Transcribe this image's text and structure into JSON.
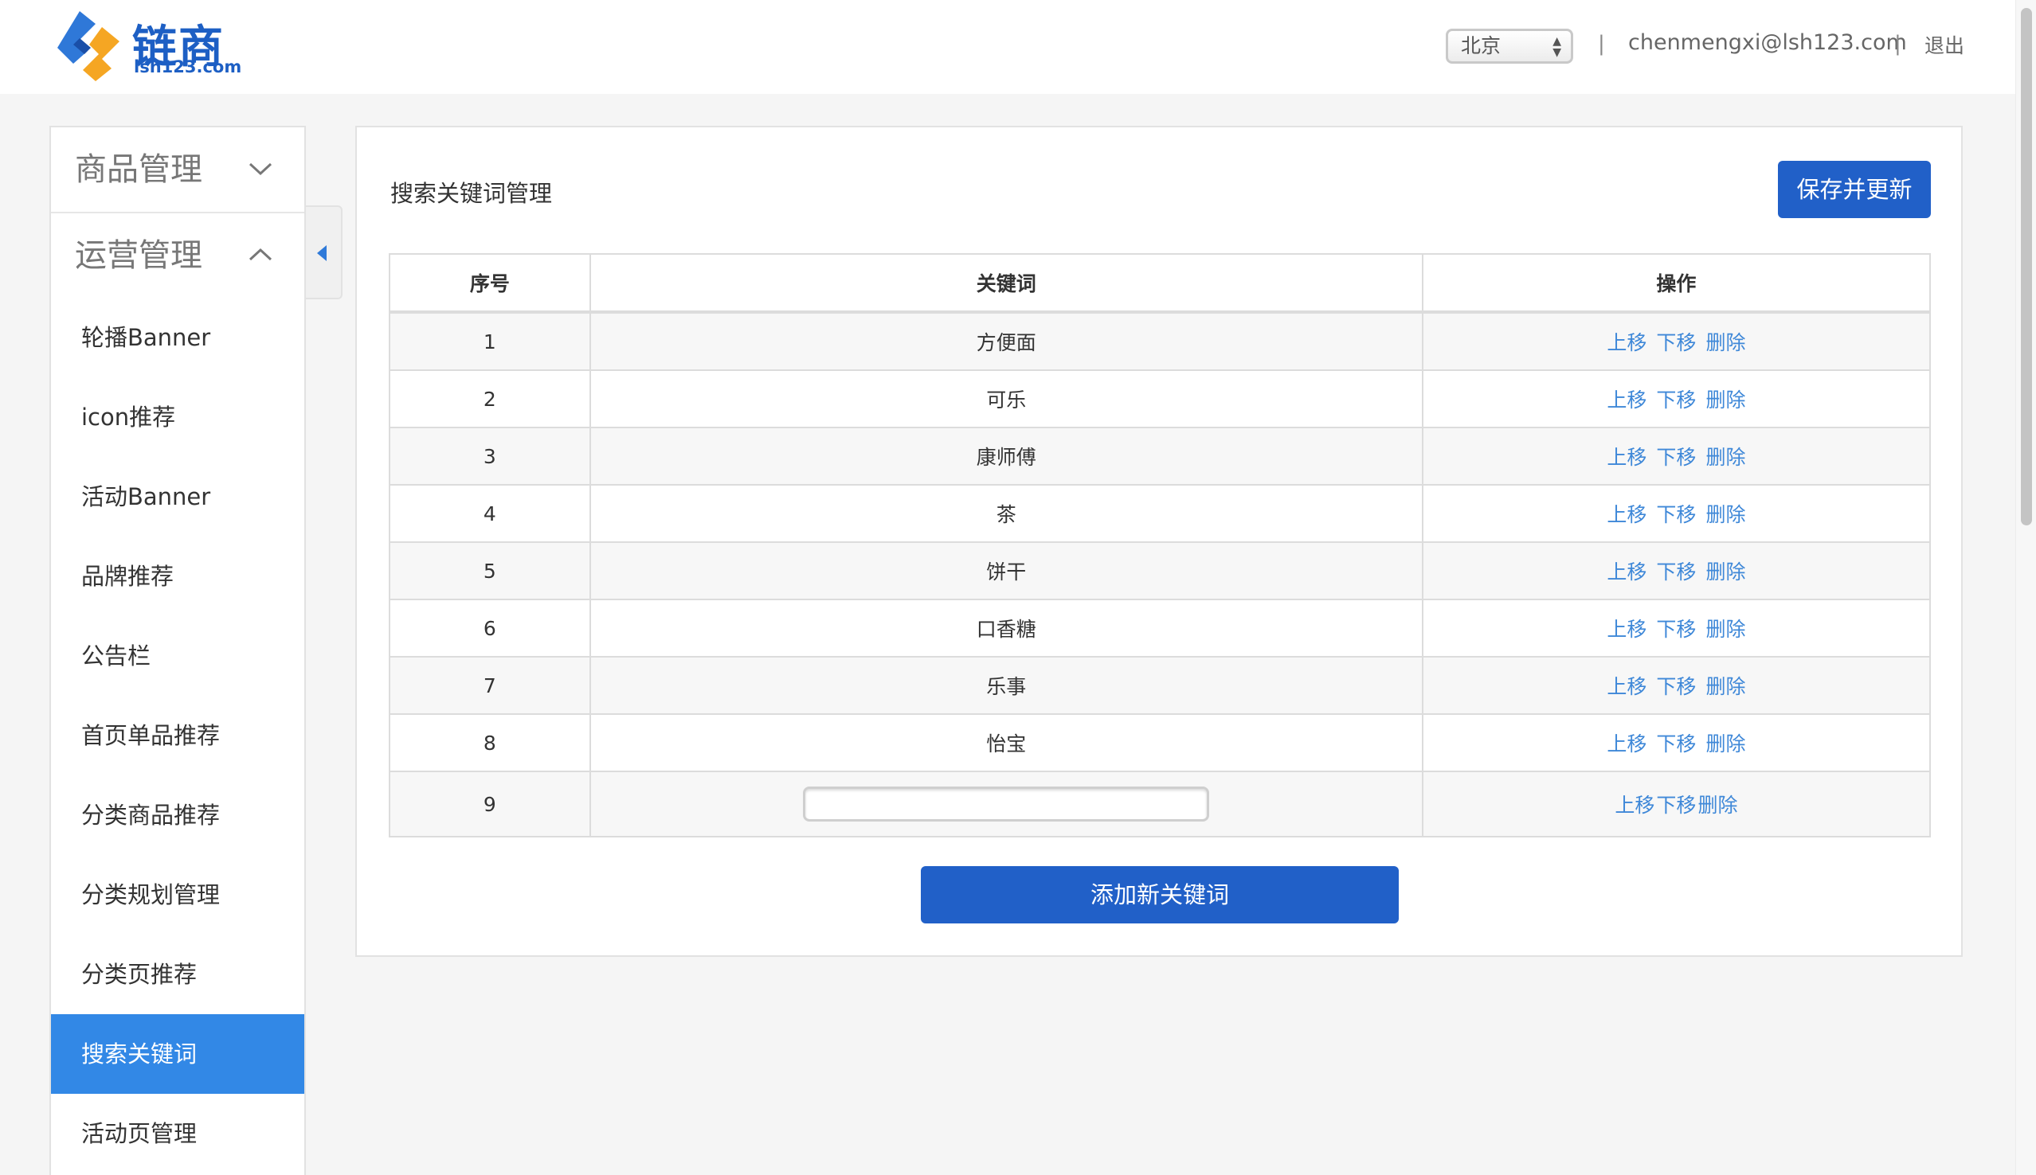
{
  "brand": {
    "name": "链商",
    "sub": "lsh123.com",
    "colors": {
      "primary": "#2160c8",
      "active": "#3288e6",
      "link": "#3f88d8"
    }
  },
  "header": {
    "city": "北京",
    "separator": "|",
    "email": "chenmengxi@lsh123.com",
    "logout": "退出"
  },
  "sidebar": {
    "groups": [
      {
        "label": "商品管理",
        "icon": "chevron-down-icon"
      },
      {
        "label": "运营管理",
        "icon": "chevron-up-icon"
      }
    ],
    "items": [
      {
        "label": "轮播Banner"
      },
      {
        "label": "icon推荐"
      },
      {
        "label": "活动Banner"
      },
      {
        "label": "品牌推荐"
      },
      {
        "label": "公告栏"
      },
      {
        "label": "首页单品推荐"
      },
      {
        "label": "分类商品推荐"
      },
      {
        "label": "分类规划管理"
      },
      {
        "label": "分类页推荐"
      },
      {
        "label": "搜索关键词",
        "active": true
      },
      {
        "label": "活动页管理"
      }
    ]
  },
  "panel": {
    "title": "搜索关键词管理",
    "save_label": "保存并更新",
    "add_label": "添加新关键词",
    "table": {
      "headers": [
        "序号",
        "关键词",
        "操作"
      ],
      "actions": {
        "up": "上移",
        "down": "下移",
        "delete": "删除"
      },
      "rows": [
        {
          "index": "1",
          "keyword": "方便面"
        },
        {
          "index": "2",
          "keyword": "可乐"
        },
        {
          "index": "3",
          "keyword": "康师傅"
        },
        {
          "index": "4",
          "keyword": "茶"
        },
        {
          "index": "5",
          "keyword": "饼干"
        },
        {
          "index": "6",
          "keyword": "口香糖"
        },
        {
          "index": "7",
          "keyword": "乐事"
        },
        {
          "index": "8",
          "keyword": "怡宝"
        }
      ],
      "new_row": {
        "index": "9",
        "value": ""
      }
    }
  }
}
